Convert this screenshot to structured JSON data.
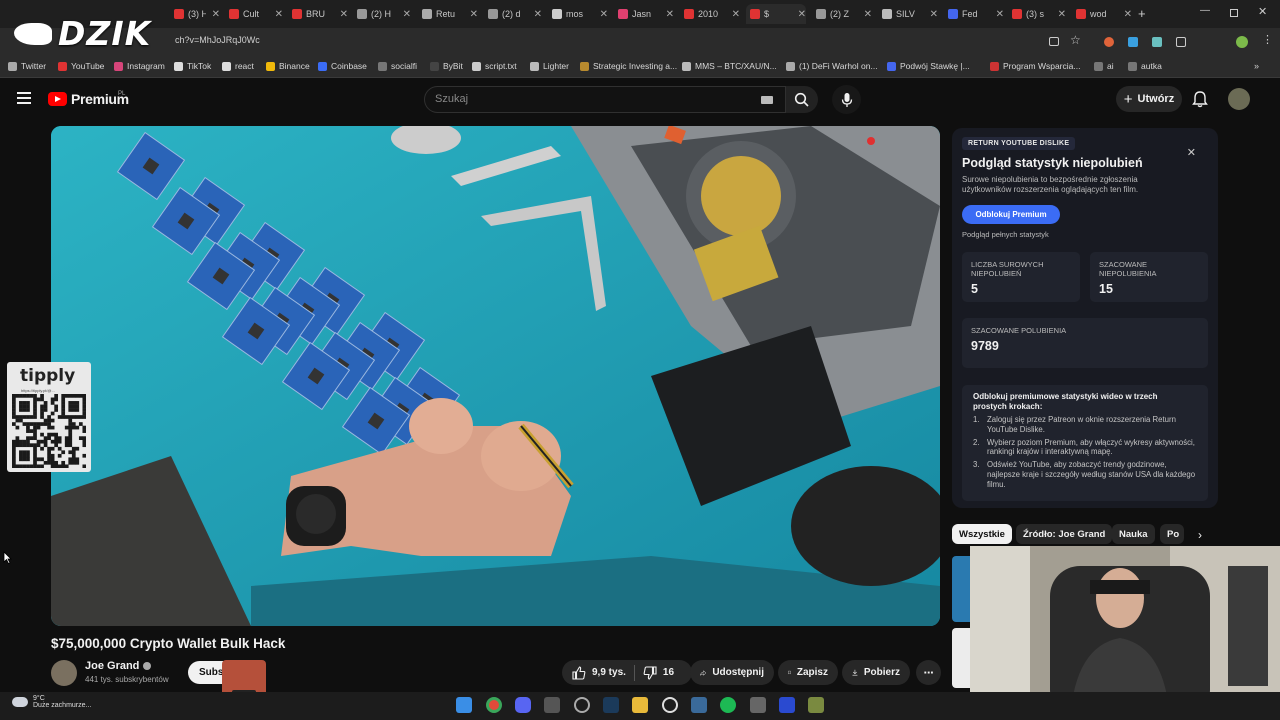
{
  "browser": {
    "tabs": [
      {
        "label": "(3) H",
        "color": "#e03333"
      },
      {
        "label": "Cult",
        "color": "#e03333"
      },
      {
        "label": "BRU",
        "color": "#e03333"
      },
      {
        "label": "(2) H",
        "color": "#999999"
      },
      {
        "label": "Retu",
        "color": "#aaaaaa"
      },
      {
        "label": "(2) d",
        "color": "#999999"
      },
      {
        "label": "mos",
        "color": "#cccccc"
      },
      {
        "label": "Jasn",
        "color": "#e04070"
      },
      {
        "label": "2010",
        "color": "#e03333"
      },
      {
        "label": "$",
        "color": "#e03333"
      },
      {
        "label": "(2) Z",
        "color": "#999999"
      },
      {
        "label": "SILV",
        "color": "#bbbbbb"
      },
      {
        "label": "Fed",
        "color": "#4466ee"
      },
      {
        "label": "(3) s",
        "color": "#e03333"
      },
      {
        "label": "wod",
        "color": "#e03333"
      }
    ],
    "url": "ch?v=MhJoJRqJ0Wc",
    "bookmarks": [
      {
        "label": "Twitter",
        "color": "#aaaaaa"
      },
      {
        "label": "YouTube",
        "color": "#e03333"
      },
      {
        "label": "Instagram",
        "color": "#d6457a"
      },
      {
        "label": "TikTok",
        "color": "#dddddd"
      },
      {
        "label": "react",
        "color": "#dddddd"
      },
      {
        "label": "Binance",
        "color": "#f0b90b"
      },
      {
        "label": "Coinbase",
        "color": "#3b6cf5"
      },
      {
        "label": "socialfi",
        "color": "#777777"
      },
      {
        "label": "ByBit",
        "color": "#444444"
      },
      {
        "label": "script.txt",
        "color": "#cccccc"
      },
      {
        "label": "Lighter",
        "color": "#bbbbbb"
      },
      {
        "label": "Strategic Investing a...",
        "color": "#b88a2e"
      },
      {
        "label": "MMS – BTC/XAU/N...",
        "color": "#bbbbbb"
      },
      {
        "label": "(1) DeFi Warhol on...",
        "color": "#aaaaaa"
      },
      {
        "label": "Podwój Stawkę |...",
        "color": "#4466ee"
      },
      {
        "label": "Program Wsparcia...",
        "color": "#cc3333"
      },
      {
        "label": "ai",
        "color": "#777777"
      },
      {
        "label": "autka",
        "color": "#777777"
      }
    ]
  },
  "overlay": {
    "brand": "DZIK",
    "tipply_logo": "tipply",
    "tipply_url": "https://tipply.pl/@..."
  },
  "masthead": {
    "premium_label": "Premium",
    "region": "PL",
    "search_placeholder": "Szukaj",
    "create_label": "Utwórz"
  },
  "video": {
    "title": "$75,000,000 Crypto Wallet Bulk Hack",
    "channel": "Joe Grand",
    "subscribers": "441 tys. subskrybentów",
    "subscribe_label": "Subskrybuj",
    "likes": "9,9 tys.",
    "dislikes": "16",
    "share_label": "Udostępnij",
    "save_label": "Zapisz",
    "download_label": "Pobierz"
  },
  "ryd": {
    "badge": "RETURN YOUTUBE DISLIKE",
    "title": "Podgląd statystyk niepolubień",
    "description": "Surowe niepolubienia to bezpośrednie zgłoszenia użytkowników rozszerzenia oglądających ten film.",
    "unlock_label": "Odblokuj Premium",
    "full_stats_label": "Podgląd pełnych statystyk",
    "raw_dislikes_label": "LICZBA SUROWYCH NIEPOLUBIEŃ",
    "raw_dislikes": "5",
    "est_dislikes_label": "SZACOWANE NIEPOLUBIENIA",
    "est_dislikes": "15",
    "est_likes_label": "SZACOWANE POLUBIENIA",
    "est_likes": "9789",
    "steps_title": "Odblokuj premiumowe statystyki wideo w trzech prostych krokach:",
    "steps": [
      "Zaloguj się przez Patreon w oknie rozszerzenia Return YouTube Dislike.",
      "Wybierz poziom Premium, aby włączyć wykresy aktywności, rankingi krajów i interaktywną mapę.",
      "Odśwież YouTube, aby zobaczyć trendy godzinowe, najlepsze kraje i szczegóły według stanów USA dla każdego filmu."
    ]
  },
  "chips": [
    "Wszystkie",
    "Źródło: Joe Grand",
    "Nauka",
    "Po"
  ],
  "taskbar": {
    "temp": "9°C",
    "weather": "Duże zachmurze..."
  },
  "colors": {
    "accent_blue": "#3b6cf5",
    "yt_red": "#ff0000",
    "mat_teal": "#1fa0b3"
  }
}
